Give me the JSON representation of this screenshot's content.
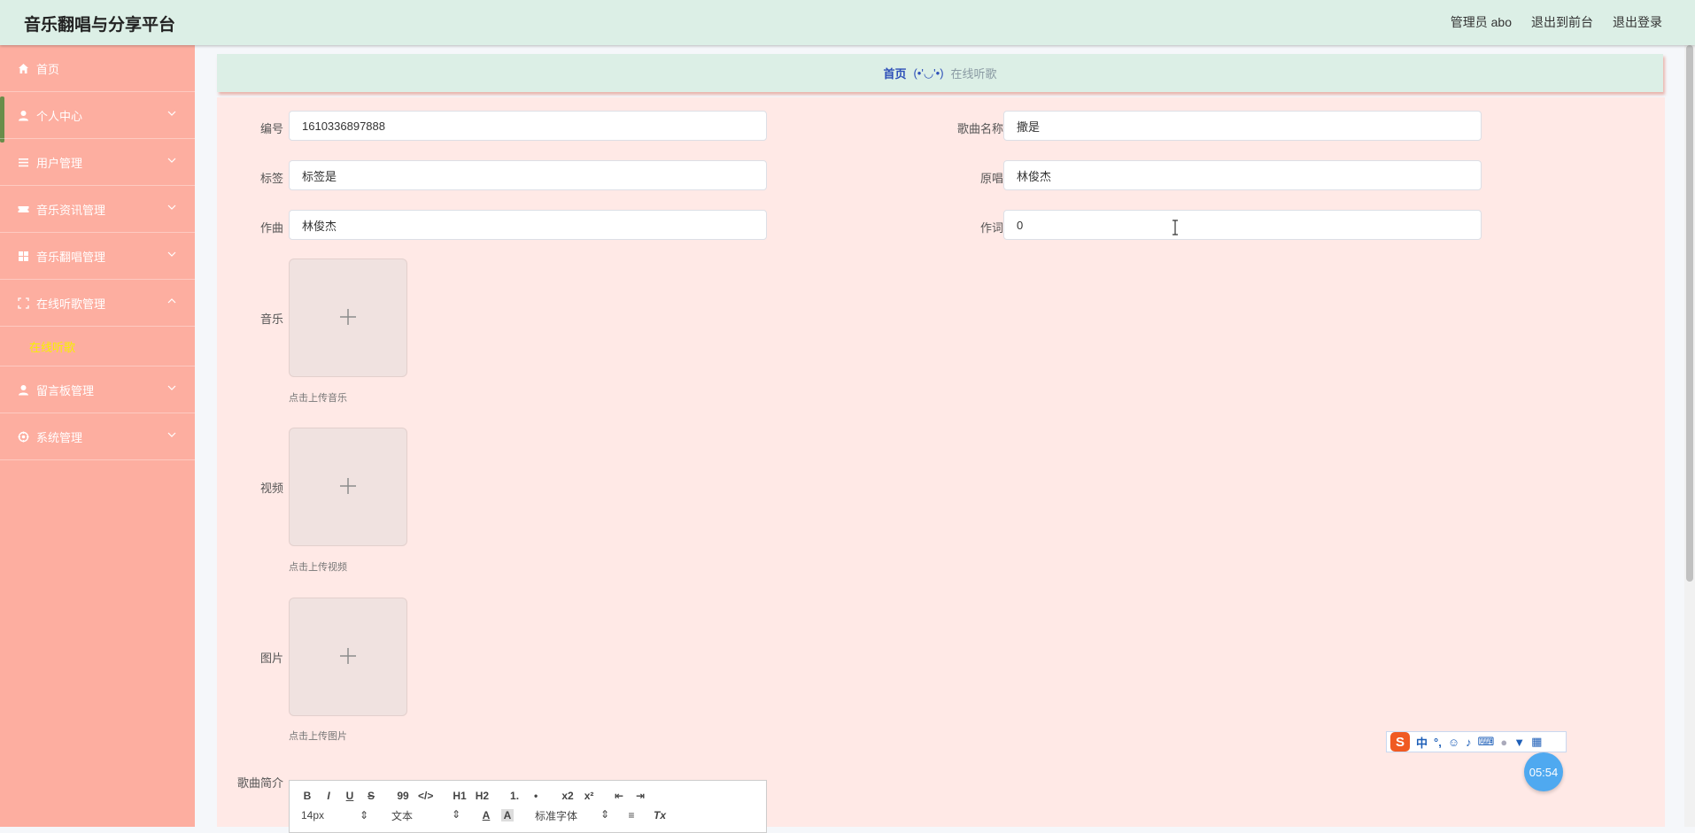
{
  "app": {
    "title": "音乐翻唱与分享平台"
  },
  "topnav": {
    "admin_label": "管理员 abo",
    "to_front_label": "退出到前台",
    "logout_label": "退出登录"
  },
  "sidebar": {
    "items": [
      {
        "label": "首页",
        "icon": "home-icon"
      },
      {
        "label": "个人中心",
        "icon": "user-icon"
      },
      {
        "label": "用户管理",
        "icon": "list-icon"
      },
      {
        "label": "音乐资讯管理",
        "icon": "ticket-icon"
      },
      {
        "label": "音乐翻唱管理",
        "icon": "grid-icon"
      },
      {
        "label": "在线听歌管理",
        "icon": "fullscreen-icon"
      },
      {
        "label": "留言板管理",
        "icon": "user-icon"
      },
      {
        "label": "系统管理",
        "icon": "settings-icon"
      }
    ],
    "sub_item": "在线听歌"
  },
  "breadcrumb": {
    "home": "首页",
    "separator": "(•'◡'•)",
    "current": "在线听歌"
  },
  "form": {
    "fields": {
      "id": {
        "label": "编号",
        "value": "1610336897888"
      },
      "song_name": {
        "label": "歌曲名称",
        "value": "撒是"
      },
      "tag": {
        "label": "标签",
        "value": "标签是"
      },
      "original_singer": {
        "label": "原唱",
        "value": "林俊杰"
      },
      "composer": {
        "label": "作曲",
        "value": "林俊杰"
      },
      "lyricist": {
        "label": "作词",
        "value": "0"
      }
    },
    "uploads": {
      "music": {
        "label": "音乐",
        "hint": "点击上传音乐"
      },
      "video": {
        "label": "视频",
        "hint": "点击上传视频"
      },
      "image": {
        "label": "图片",
        "hint": "点击上传图片"
      }
    },
    "intro": {
      "label": "歌曲简介"
    }
  },
  "editor": {
    "row1": [
      "B",
      "I",
      "U",
      "S",
      "99",
      "</>",
      "H1",
      "H2",
      "1.",
      "•",
      "x2",
      "x²",
      "⇤",
      "⇥"
    ],
    "font_size": "14px",
    "text_type": "文本",
    "font_family": "标准字体"
  },
  "tray": {
    "ime_mode": "中",
    "clock": "05:54"
  },
  "colors": {
    "topbar": "#dcefe6",
    "sidebar": "#fdaea0",
    "main": "#ffe9e6",
    "active_sub": "#f8f000",
    "breadcrumb_home": "#2d4fb8"
  }
}
